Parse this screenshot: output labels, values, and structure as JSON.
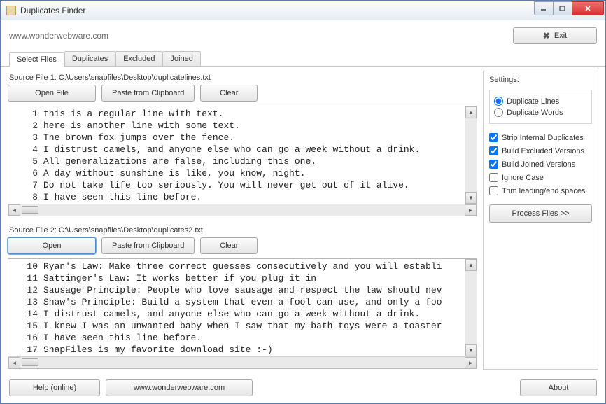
{
  "window": {
    "title": "Duplicates Finder"
  },
  "header": {
    "url": "www.wonderwebware.com",
    "exit": "Exit"
  },
  "tabs": [
    "Select Files",
    "Duplicates",
    "Excluded",
    "Joined"
  ],
  "file1": {
    "label": "Source File 1: C:\\Users\\snapfiles\\Desktop\\duplicatelines.txt",
    "open": "Open File",
    "paste": "Paste from Clipboard",
    "clear": "Clear",
    "lines": [
      {
        "n": "1",
        "t": "this is a regular line with text."
      },
      {
        "n": "2",
        "t": "here is another line with some text."
      },
      {
        "n": "3",
        "t": "The brown fox jumps over the fence."
      },
      {
        "n": "4",
        "t": "I distrust camels, and anyone else who can go a week without a drink."
      },
      {
        "n": "5",
        "t": "All generalizations are false, including this one."
      },
      {
        "n": "6",
        "t": "A day without sunshine is like, you know, night."
      },
      {
        "n": "7",
        "t": "Do not take life too seriously. You will never get out of it alive."
      },
      {
        "n": "8",
        "t": "I have seen this line before."
      }
    ]
  },
  "file2": {
    "label": "Source File 2: C:\\Users\\snapfiles\\Desktop\\duplicates2.txt",
    "open": "Open",
    "paste": "Paste from Clipboard",
    "clear": "Clear",
    "lines": [
      {
        "n": "10",
        "t": "Ryan's Law: Make three correct guesses consecutively and you will establi"
      },
      {
        "n": "11",
        "t": "Sattinger's Law: It works better if you plug it in"
      },
      {
        "n": "12",
        "t": "Sausage Principle: People who love sausage and respect the law should nev"
      },
      {
        "n": "13",
        "t": "Shaw's Principle: Build a system that even a fool can use, and only a foo"
      },
      {
        "n": "14",
        "t": "I distrust camels, and anyone else who can go a week without a drink."
      },
      {
        "n": "15",
        "t": "I knew I was an unwanted baby when I saw that my bath toys were a toaster"
      },
      {
        "n": "16",
        "t": "I have seen this line before."
      },
      {
        "n": "17",
        "t": "SnapFiles is my favorite download site :-)"
      }
    ]
  },
  "settings": {
    "title": "Settings:",
    "radio1": "Duplicate Lines",
    "radio2": "Duplicate Words",
    "chk1": "Strip Internal Duplicates",
    "chk2": "Build Excluded Versions",
    "chk3": "Build Joined Versions",
    "chk4": "Ignore Case",
    "chk5": "Trim leading/end spaces",
    "process": "Process Files  >>"
  },
  "footer": {
    "help": "Help (online)",
    "url": "www.wonderwebware.com",
    "about": "About"
  }
}
